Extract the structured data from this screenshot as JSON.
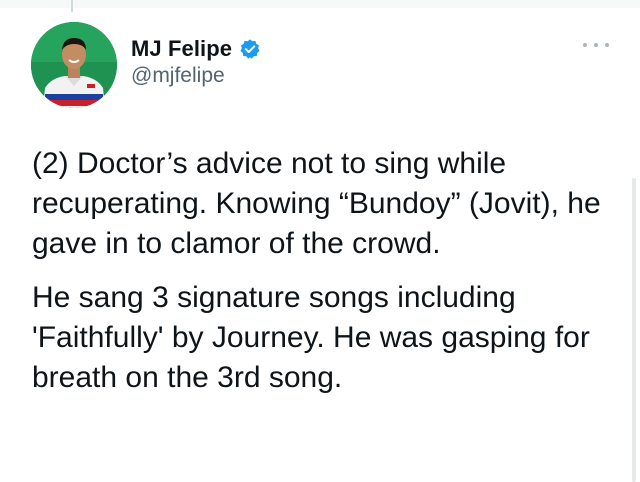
{
  "author": {
    "display_name": "MJ Felipe",
    "handle": "@mjfelipe",
    "verified": true
  },
  "icons": {
    "verified": "verified-badge-icon",
    "more": "more-options-icon",
    "avatar": "profile-avatar"
  },
  "tweet": {
    "paragraphs": [
      "(2) Doctor’s advice not to sing while recuperating. Knowing “Bundoy” (Jovit), he gave in to clamor of the crowd.",
      "He sang 3 signature songs including 'Faithfully' by Journey. He was gasping for breath on the 3rd song."
    ]
  },
  "colors": {
    "verified": "#1d9bf0",
    "text": "#0f1419",
    "secondary": "#536471"
  }
}
